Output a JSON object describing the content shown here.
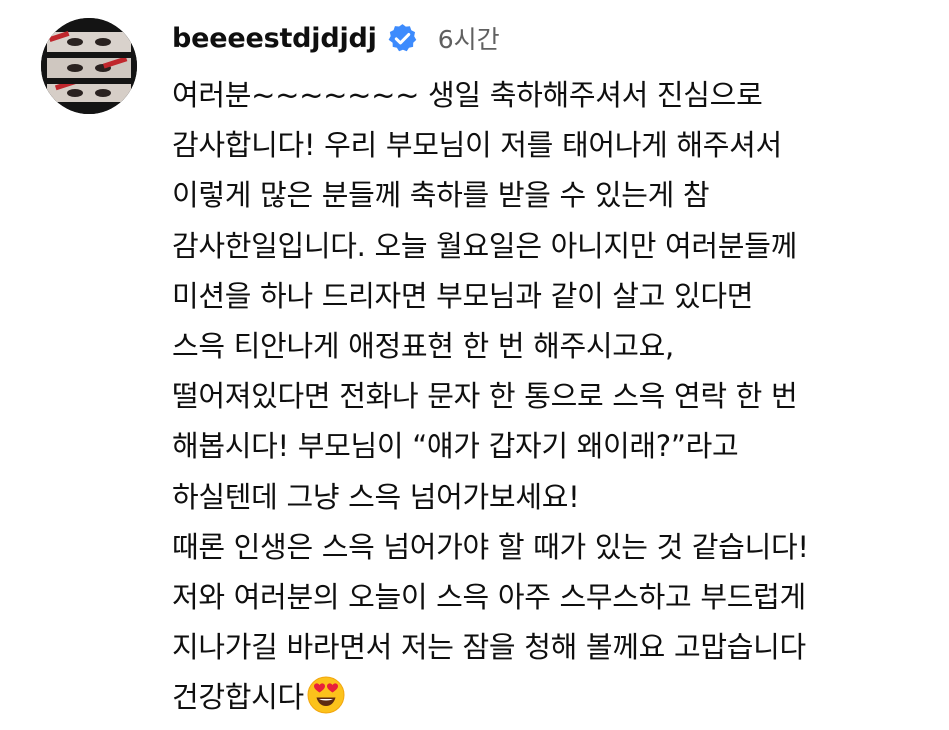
{
  "comment": {
    "username": "beeeestdjdjdj",
    "verified_icon": "verified-badge-icon",
    "timestamp": "6시간",
    "lines": [
      "여러분~~~~~~~ 생일 축하해주셔서 진심으로",
      "감사합니다! 우리 부모님이 저를 태어나게 해주셔서",
      "이렇게 많은 분들께 축하를 받을 수 있는게 참",
      "감사한일입니다. 오늘 월요일은 아니지만 여러분들께",
      "미션을 하나 드리자면 부모님과 같이 살고 있다면",
      "스윽 티안나게 애정표현 한 번 해주시고요,",
      "떨어져있다면 전화나 문자 한 통으로 스윽 연락 한 번",
      "해봅시다! 부모님이 “얘가 갑자기 왜이래?”라고",
      "하실텐데 그냥 스윽 넘어가보세요!",
      "때론 인생은 스윽 넘어가야 할 때가 있는 것 같습니다!",
      "저와 여러분의 오늘이 스윽 아주 스무스하고 부드럽게",
      "지나가길 바라면서 저는 잠을 청해 볼께요 고맙습니다",
      "건강합시다"
    ],
    "emoji_icon": "heart-eyes-emoji-icon",
    "colors": {
      "text": "#0f0f0f",
      "timestamp": "#606060",
      "verified": "#3d8bfd"
    }
  }
}
